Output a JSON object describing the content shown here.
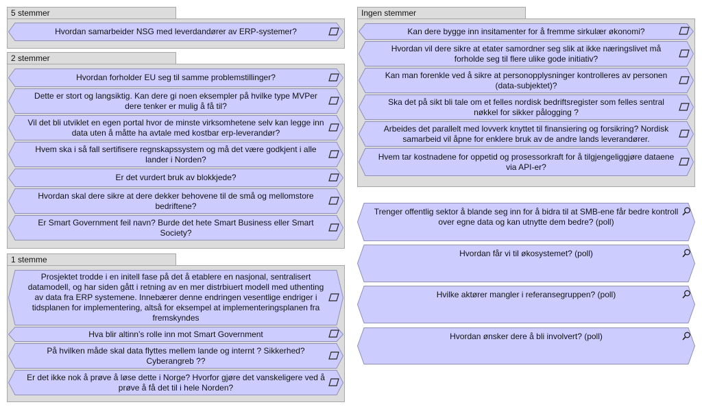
{
  "groups": {
    "g5": {
      "title": "5 stemmer",
      "items": [
        "Hvordan samarbeider NSG med leverdandører av ERP-systemer?"
      ]
    },
    "g2": {
      "title": "2 stemmer",
      "items": [
        "Hvordan forholder EU seg til samme problemstillinger?",
        "Dette er stort og langsiktig. Kan dere gi noen eksempler på hvilke type MVPer dere tenker er mulig å få til?",
        "Vil det bli utviklet en egen portal hvor de minste virksomhetene selv kan legge inn data uten å måtte ha avtale med kostbar erp-leverandør?",
        "Hvem ska i så fall sertifisere regnskapssystem og må det være godkjent i alle lander i Norden?",
        "Er det vurdert bruk av blokkjede?",
        "Hvordan skal dere sikre at dere dekker behovene til de små og mellomstore bedriftene?",
        "Er Smart Government feil navn? Burde det hete Smart Business eller Smart Society?"
      ]
    },
    "g1": {
      "title": "1 stemme",
      "items": [
        "Prosjektet trodde i en initell fase på det å etablere en nasjonal, sentralisert datamodell, og har siden gått i retning av en mer distrbiuert modell med uthenting av data fra ERP systemene. Innebærer denne endringen vesentlige endriger i tidsplanen for implementering, altså for eksempel at implementeringsplanen fra fremskyndes",
        "Hva blir altinn’s rolle inn mot Smart Government",
        "På hvilken måde skal data flyttes mellem lande og internt ? Sikkerhed? Cyberangreb ??",
        "Er det ikke nok å prøve å løse dette i Norge? Hvorfor gjøre det vanskeligere ved å prøve å få det til i hele Norden?"
      ]
    },
    "g0": {
      "title": "Ingen stemmer",
      "items": [
        "Kan dere bygge inn insitamenter for å fremme sirkulær økonomi?",
        "Hvordan vil dere sikre at etater samordner seg slik at ikke næringslivet må forholde seg til flere ulike gode initiativ?",
        "Kan man forenkle ved å sikre at personopplysninger kontrolleres av personen (data-subjektet)?",
        "Ska det på sikt bli tale om et felles nordisk bedriftsregister som felles sentral nøkkel for sikker pålogging ?",
        "Arbeides det parallelt med lovverk knyttet til finansiering og forsikring? Nordisk samarbeid vil åpne for enklere bruk av de andre lands leverandører.",
        "Hvem tar kostnadene for oppetid og prosessorkraft for å tilgjengeliggjøre dataene via API-er?"
      ]
    }
  },
  "polls": [
    "Trenger offentlig sektor å blande seg inn for å bidra til at SMB-ene får bedre kontroll over egne data og kan utnytte dem bedre?  (poll)",
    "Hvordan får vi til økosystemet? (poll)",
    "Hvilke aktører mangler i referansegruppen? (poll)",
    "Hvordan ønsker dere å bli involvert? (poll)"
  ],
  "icons": {
    "card": "parallelogram-icon",
    "poll": "magnifier-icon"
  },
  "colors": {
    "card_fill": "#ccccff",
    "card_border": "#8f8fb8",
    "group_bg": "#dcdcdc"
  }
}
